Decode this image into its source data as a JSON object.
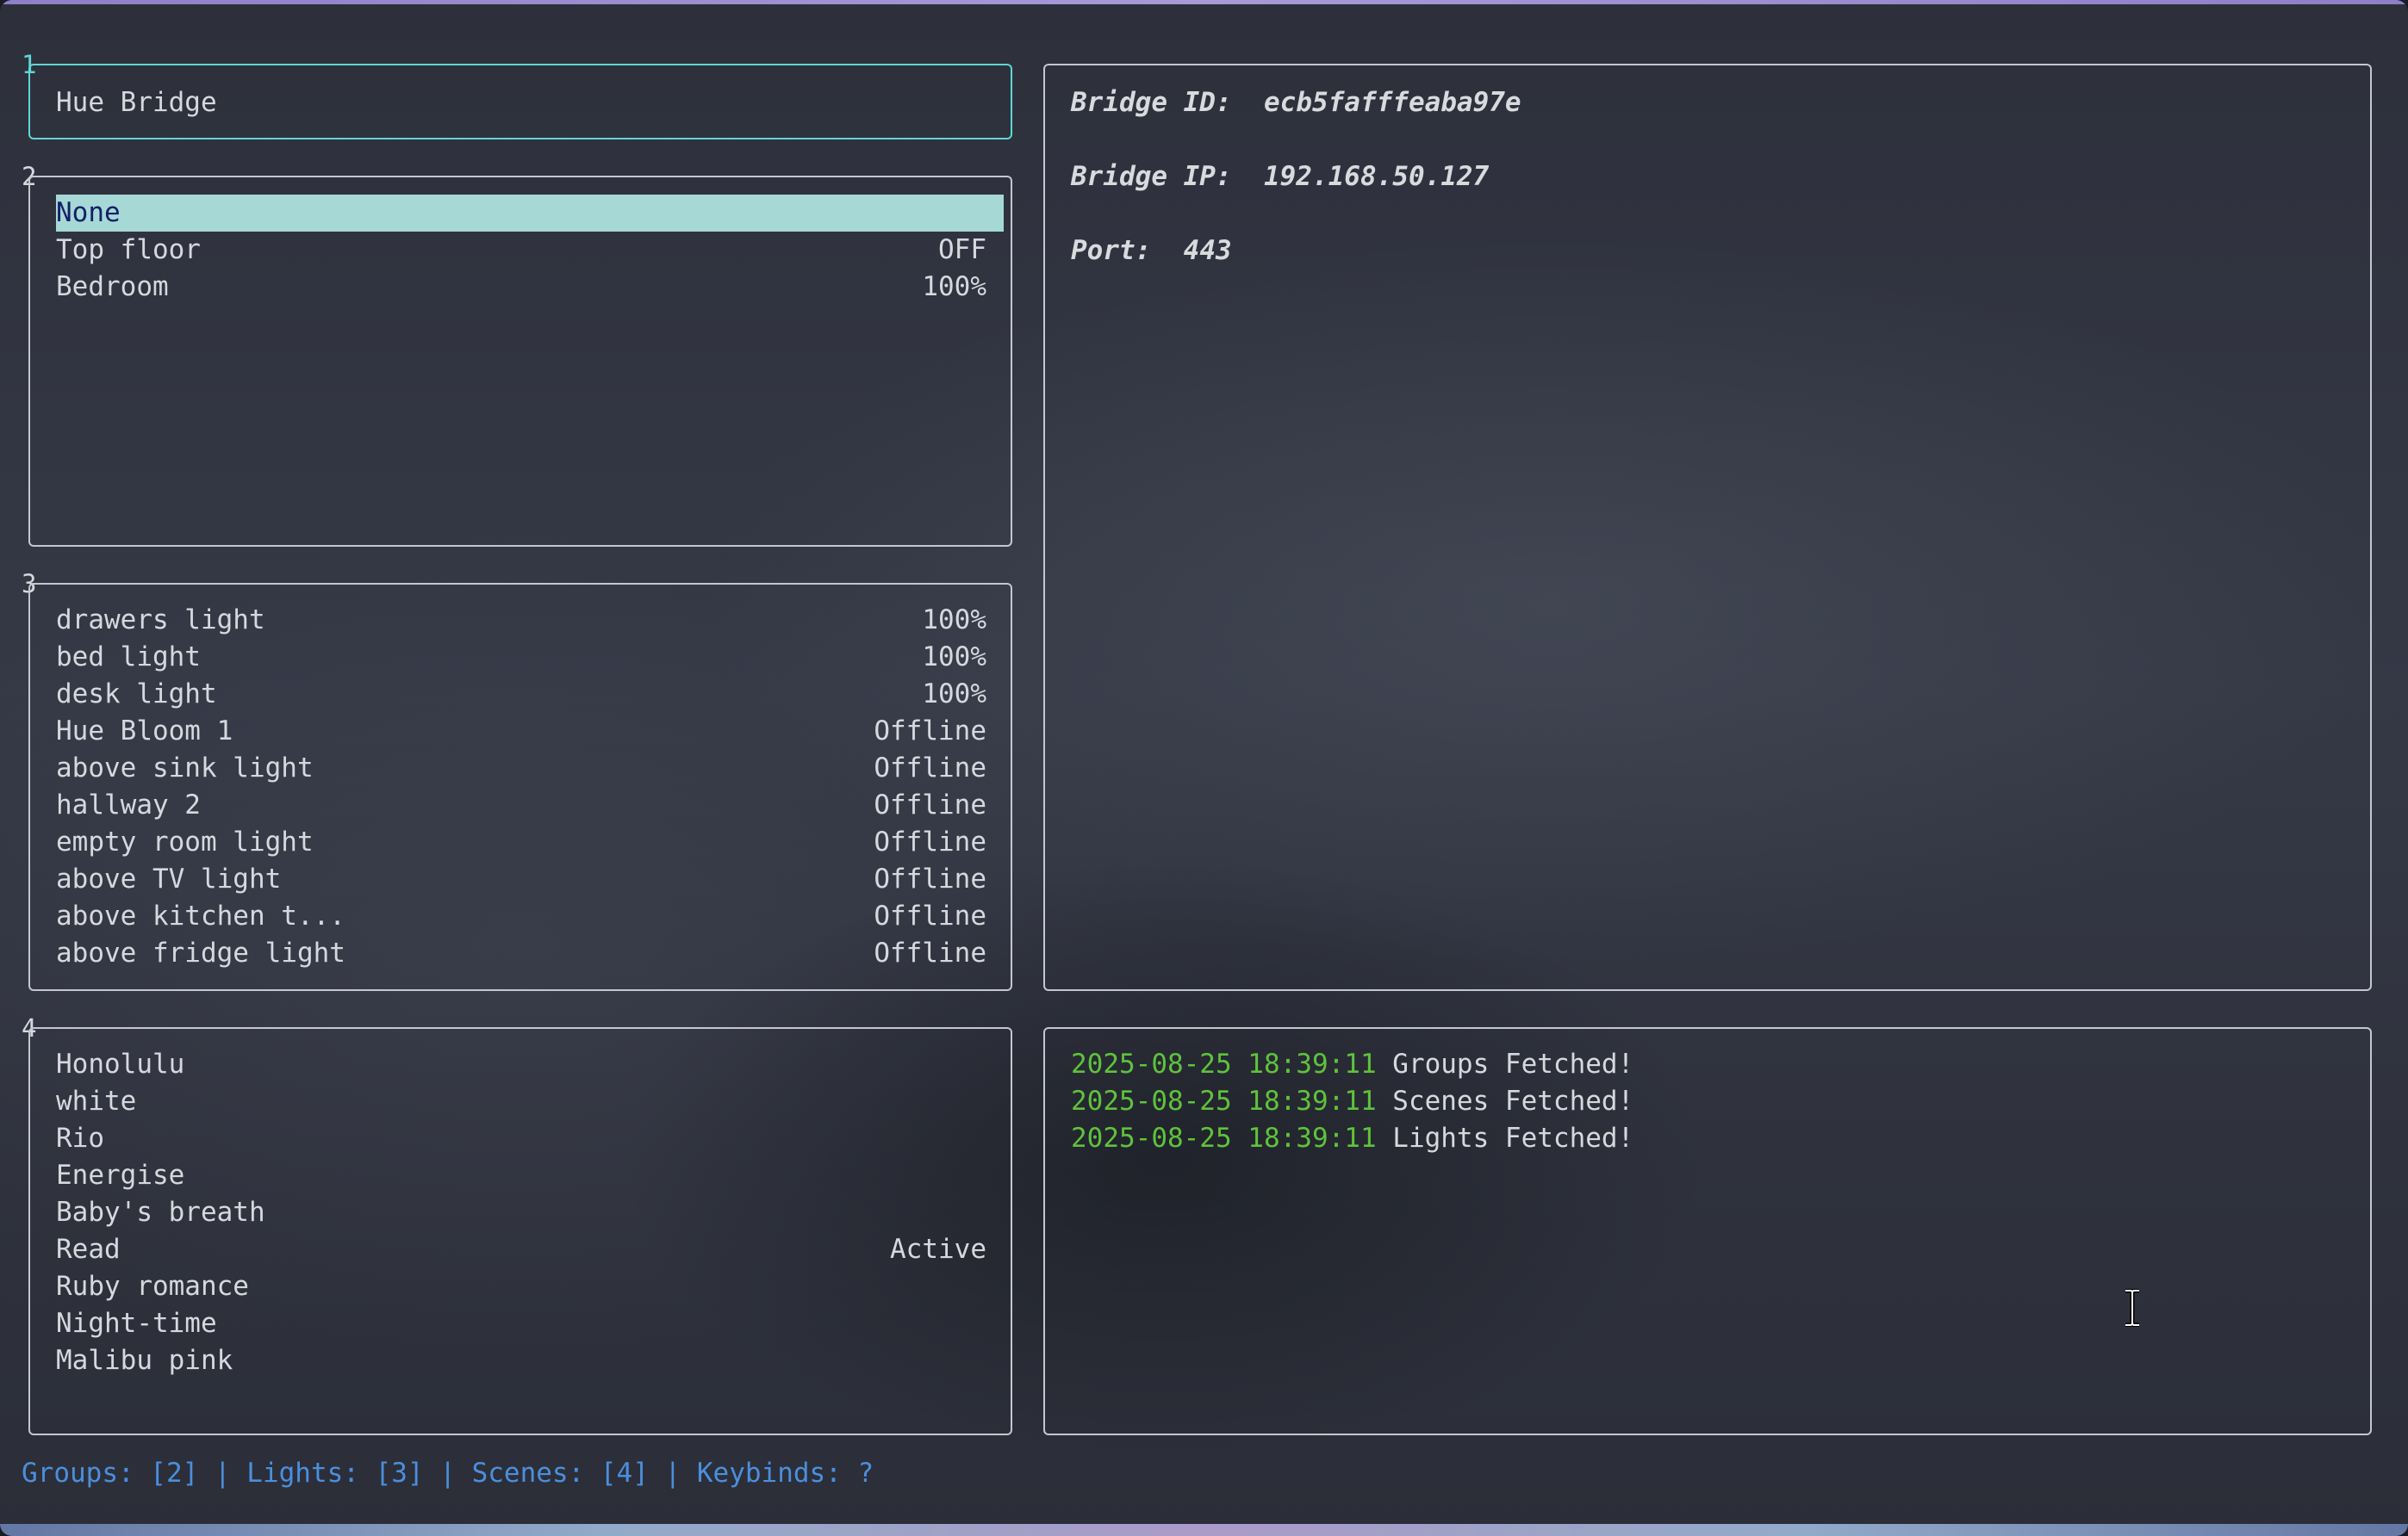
{
  "panel1": {
    "number": "1",
    "title": "Hue Bridge"
  },
  "groups_panel": {
    "number": "2",
    "items": [
      {
        "name": "None",
        "status": ""
      },
      {
        "name": "Top floor",
        "status": "OFF"
      },
      {
        "name": "Bedroom",
        "status": "100%"
      }
    ],
    "selected": "None"
  },
  "lights_panel": {
    "number": "3",
    "items": [
      {
        "name": "drawers light",
        "status": "100%"
      },
      {
        "name": "bed light",
        "status": "100%"
      },
      {
        "name": "desk light",
        "status": "100%"
      },
      {
        "name": "Hue Bloom 1",
        "status": "Offline"
      },
      {
        "name": "above sink light",
        "status": "Offline"
      },
      {
        "name": "hallway 2",
        "status": "Offline"
      },
      {
        "name": "empty room light",
        "status": "Offline"
      },
      {
        "name": "above TV light",
        "status": "Offline"
      },
      {
        "name": "above kitchen t...",
        "status": "Offline"
      },
      {
        "name": "above fridge light",
        "status": "Offline"
      }
    ]
  },
  "scenes_panel": {
    "number": "4",
    "items": [
      {
        "name": "Honolulu",
        "status": ""
      },
      {
        "name": "white",
        "status": ""
      },
      {
        "name": "Rio",
        "status": ""
      },
      {
        "name": "Energise",
        "status": ""
      },
      {
        "name": "Baby's breath",
        "status": ""
      },
      {
        "name": "Read",
        "status": "Active"
      },
      {
        "name": "Ruby romance",
        "status": ""
      },
      {
        "name": "Night-time",
        "status": ""
      },
      {
        "name": "Malibu pink",
        "status": ""
      }
    ]
  },
  "bridge_info": {
    "id_label": "Bridge ID:",
    "id_value": "ecb5fafffeaba97e",
    "ip_label": "Bridge IP:",
    "ip_value": "192.168.50.127",
    "port_label": "Port:",
    "port_value": "443"
  },
  "log": [
    {
      "time": "2025-08-25 18:39:11",
      "message": "Groups Fetched!"
    },
    {
      "time": "2025-08-25 18:39:11",
      "message": "Scenes Fetched!"
    },
    {
      "time": "2025-08-25 18:39:11",
      "message": "Lights Fetched!"
    }
  ],
  "statusbar": {
    "text": "Groups: [2] | Lights: [3] | Scenes: [4] | Keybinds: ?"
  },
  "colors": {
    "focus_border": "#5fd7d7",
    "selection_bg": "#a6d8d6",
    "selection_fg": "#14206a",
    "log_time": "#5fc23b",
    "statusbar": "#4b8fdc"
  },
  "icons": {
    "mouse_cursor": "text-cursor-icon"
  }
}
